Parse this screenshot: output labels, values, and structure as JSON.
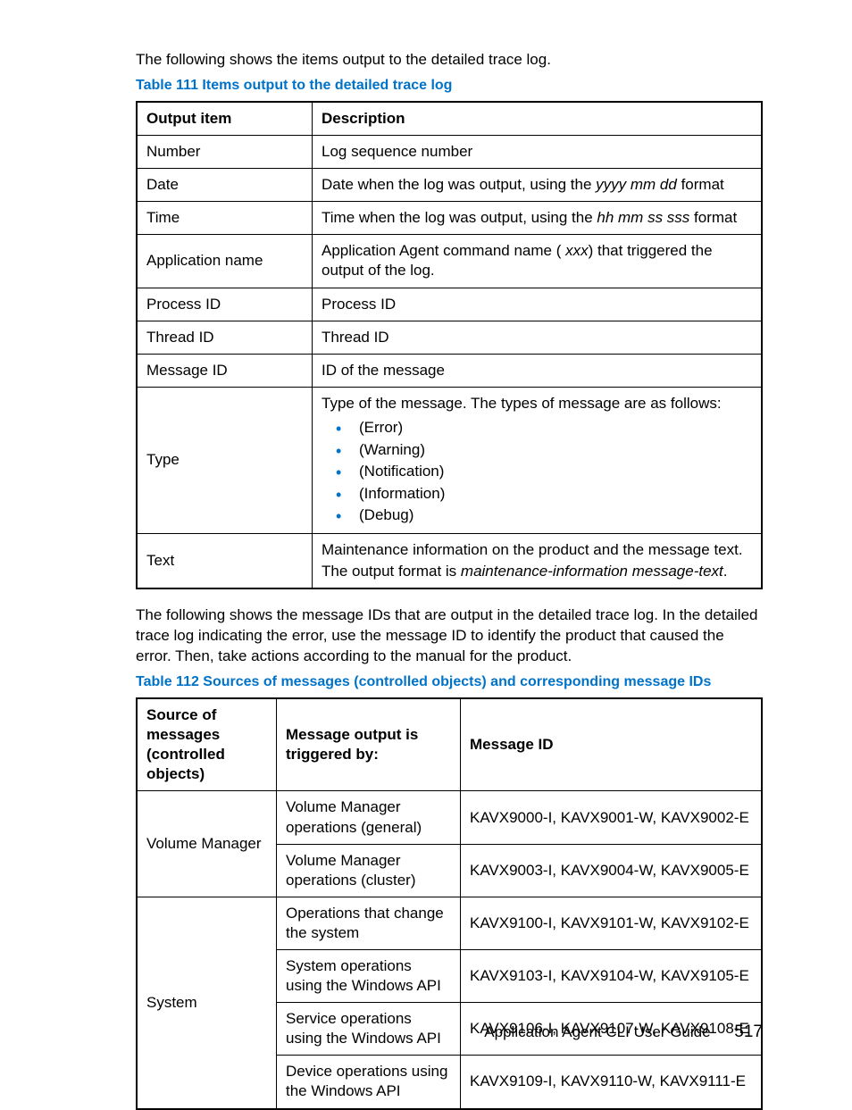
{
  "intro1": "The following shows the items output to the detailed trace log.",
  "caption1": "Table 111 Items output to the detailed trace log",
  "t111": {
    "h1": "Output item",
    "h2": "Description",
    "rows": [
      {
        "c1": "Number",
        "c2": "Log sequence number"
      },
      {
        "c1": "Date",
        "c2_pre": "Date when the log was output, using the ",
        "c2_it": "yyyy mm dd",
        "c2_post": " format"
      },
      {
        "c1": "Time",
        "c2_pre": "Time when the log was output, using the ",
        "c2_it": "hh mm ss sss",
        "c2_post": " format"
      },
      {
        "c1": "Application name",
        "c2_pre": "Application Agent command name (",
        "c2_it": "      xxx",
        "c2_post": ") that triggered the output of the log."
      },
      {
        "c1": "Process ID",
        "c2": "Process ID"
      },
      {
        "c1": "Thread ID",
        "c2": "Thread ID"
      },
      {
        "c1": "Message ID",
        "c2": "ID of the message"
      }
    ],
    "type_row": {
      "c1": "Type",
      "lead": "Type of the message. The types of message are as follows:",
      "items": [
        "(Error)",
        "(Warning)",
        "(Notification)",
        "(Information)",
        "(Debug)"
      ]
    },
    "text_row": {
      "c1": "Text",
      "l1": "Maintenance information on the product and the message text.",
      "l2_pre": "The output format is ",
      "l2_it": "maintenance-information message-text",
      "l2_post": "."
    }
  },
  "intro2": "The following shows the message IDs that are output in the detailed trace log. In the detailed trace log indicating the error, use the message ID to identify the product that caused the error. Then, take actions according to the manual for the product.",
  "caption2": "Table 112 Sources of messages (controlled objects) and corresponding message IDs",
  "t112": {
    "h1": "Source of messages (controlled objects)",
    "h2": "Message output is triggered by:",
    "h3": "Message ID",
    "g1": {
      "src": "Volume Manager",
      "r1t": "Volume Manager operations (general)",
      "r1m": "KAVX9000-I, KAVX9001-W, KAVX9002-E",
      "r2t": "Volume Manager operations (cluster)",
      "r2m": "KAVX9003-I, KAVX9004-W, KAVX9005-E"
    },
    "g2": {
      "src": "System",
      "r1t": "Operations that change the system",
      "r1m": "KAVX9100-I, KAVX9101-W, KAVX9102-E",
      "r2t": "System operations using the Windows API",
      "r2m": "KAVX9103-I, KAVX9104-W, KAVX9105-E",
      "r3t": "Service operations using the Windows API",
      "r3m": "KAVX9106-I, KAVX9107-W, KAVX9108-E",
      "r4t": "Device operations using the Windows API",
      "r4m": "KAVX9109-I, KAVX9110-W, KAVX9111-E"
    }
  },
  "footer_title": "Application Agent CLI User Guide",
  "footer_page": "517"
}
